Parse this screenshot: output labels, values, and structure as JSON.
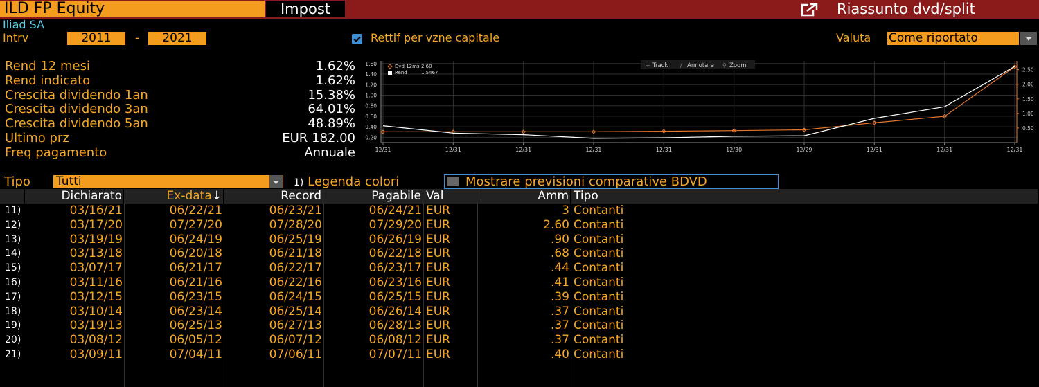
{
  "header": {
    "ticker": "ILD FP Equity",
    "impost_label": "Impost",
    "summary_title": "Riassunto dvd/split",
    "company_name": "Iliad SA"
  },
  "interval": {
    "label": "Intrv",
    "from": "2011",
    "separator": "-",
    "to": "2021",
    "rettif_label": "Rettif per vzne capitale",
    "rettif_checked": true,
    "valuta_label": "Valuta",
    "valuta_value": "Come riportato"
  },
  "stats": [
    {
      "label": "Rend 12 mesi",
      "value": "1.62%"
    },
    {
      "label": "Rend indicato",
      "value": "1.62%"
    },
    {
      "label": "Crescita dividendo 1an",
      "value": "15.38%"
    },
    {
      "label": "Crescita dividendo 3an",
      "value": "64.01%"
    },
    {
      "label": "Crescita dividendo 5an",
      "value": "48.89%"
    },
    {
      "label": "Ultimo prz",
      "value": "EUR 182.00"
    },
    {
      "label": "Freq pagamento",
      "value": "Annuale"
    }
  ],
  "chart_controls": {
    "track": "Track",
    "annotate": "Annotare",
    "zoom": "Zoom"
  },
  "chart_data": {
    "type": "line",
    "categories": [
      "12/31",
      "12/31",
      "12/31",
      "12/31",
      "12/31",
      "12/30",
      "12/29",
      "12/31",
      "12/31",
      "12/31"
    ],
    "series": [
      {
        "name": "Dvd 12ms",
        "legend_value": "2.60",
        "color": "#e8772e",
        "axis": "right",
        "values": [
          0.37,
          0.37,
          0.37,
          0.37,
          0.39,
          0.41,
          0.44,
          0.68,
          0.9,
          2.6
        ]
      },
      {
        "name": "Rend",
        "legend_value": "1.5467",
        "color": "#ffffff",
        "axis": "left",
        "values": [
          0.42,
          0.28,
          0.25,
          0.18,
          0.19,
          0.22,
          0.23,
          0.56,
          0.78,
          1.5467
        ]
      }
    ],
    "left_ticks": [
      "1.60",
      "1.40",
      "1.20",
      "1.00",
      "0.80",
      "0.60",
      "0.40",
      "0.20"
    ],
    "right_ticks": [
      "2.50",
      "2.00",
      "1.50",
      "1.00",
      "0.50"
    ],
    "ylim_left": [
      0.1,
      1.65
    ],
    "ylim_right": [
      0.0,
      2.8
    ],
    "grid": true,
    "legend": "top-left"
  },
  "filter": {
    "tipo_label": "Tipo",
    "tipo_value": "Tutti",
    "legend_num": "1)",
    "legend_label": "Legenda colori",
    "bdvd_label": "Mostrare previsioni comparative BDVD"
  },
  "table": {
    "headers": {
      "declared": "Dichiarato",
      "exdate": "Ex-data",
      "exdate_sort": "↓",
      "record": "Record",
      "payable": "Pagabile",
      "currency": "Val",
      "amount": "Amm",
      "type": "Tipo"
    },
    "rows": [
      {
        "idx": "11)",
        "declared": "03/16/21",
        "exdate": "06/22/21",
        "record": "06/23/21",
        "payable": "06/24/21",
        "currency": "EUR",
        "amount": "3",
        "type": "Contanti"
      },
      {
        "idx": "12)",
        "declared": "03/17/20",
        "exdate": "07/27/20",
        "record": "07/28/20",
        "payable": "07/29/20",
        "currency": "EUR",
        "amount": "2.60",
        "type": "Contanti"
      },
      {
        "idx": "13)",
        "declared": "03/19/19",
        "exdate": "06/24/19",
        "record": "06/25/19",
        "payable": "06/26/19",
        "currency": "EUR",
        "amount": ".90",
        "type": "Contanti"
      },
      {
        "idx": "14)",
        "declared": "03/13/18",
        "exdate": "06/20/18",
        "record": "06/21/18",
        "payable": "06/22/18",
        "currency": "EUR",
        "amount": ".68",
        "type": "Contanti"
      },
      {
        "idx": "15)",
        "declared": "03/07/17",
        "exdate": "06/21/17",
        "record": "06/22/17",
        "payable": "06/23/17",
        "currency": "EUR",
        "amount": ".44",
        "type": "Contanti"
      },
      {
        "idx": "16)",
        "declared": "03/11/16",
        "exdate": "06/21/16",
        "record": "06/22/16",
        "payable": "06/23/16",
        "currency": "EUR",
        "amount": ".41",
        "type": "Contanti"
      },
      {
        "idx": "17)",
        "declared": "03/12/15",
        "exdate": "06/23/15",
        "record": "06/24/15",
        "payable": "06/25/15",
        "currency": "EUR",
        "amount": ".39",
        "type": "Contanti"
      },
      {
        "idx": "18)",
        "declared": "03/10/14",
        "exdate": "06/23/14",
        "record": "06/25/14",
        "payable": "06/26/14",
        "currency": "EUR",
        "amount": ".37",
        "type": "Contanti"
      },
      {
        "idx": "19)",
        "declared": "03/19/13",
        "exdate": "06/25/13",
        "record": "06/27/13",
        "payable": "06/28/13",
        "currency": "EUR",
        "amount": ".37",
        "type": "Contanti"
      },
      {
        "idx": "20)",
        "declared": "03/08/12",
        "exdate": "06/05/12",
        "record": "06/07/12",
        "payable": "06/08/12",
        "currency": "EUR",
        "amount": ".37",
        "type": "Contanti"
      },
      {
        "idx": "21)",
        "declared": "03/09/11",
        "exdate": "07/04/11",
        "record": "07/06/11",
        "payable": "07/07/11",
        "currency": "EUR",
        "amount": ".40",
        "type": "Contanti"
      }
    ]
  }
}
